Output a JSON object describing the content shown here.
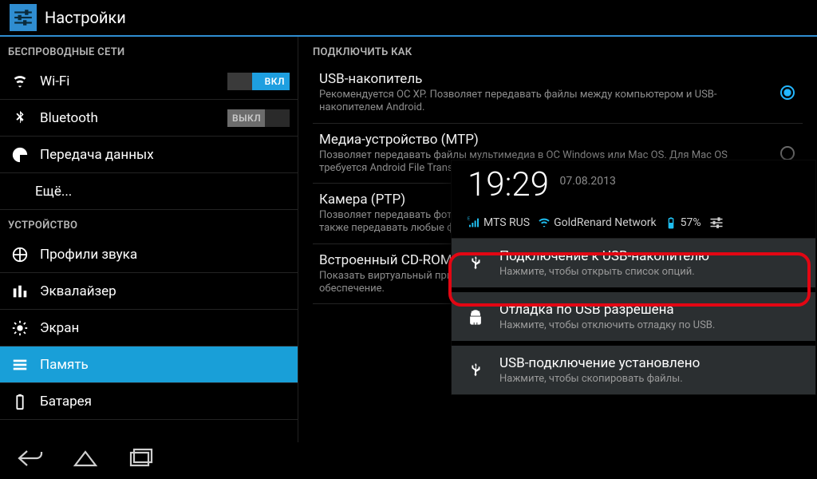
{
  "titlebar": {
    "title": "Настройки"
  },
  "sidebar": {
    "section_wireless": "БЕСПРОВОДНЫЕ СЕТИ",
    "section_device": "УСТРОЙСТВО",
    "wifi": {
      "label": "Wi-Fi",
      "toggle": "ВКЛ"
    },
    "bluetooth": {
      "label": "Bluetooth",
      "toggle": "ВЫКЛ"
    },
    "data": {
      "label": "Передача данных"
    },
    "more": {
      "label": "Ещё..."
    },
    "sound": {
      "label": "Профили звука"
    },
    "eq": {
      "label": "Эквалайзер"
    },
    "display": {
      "label": "Экран"
    },
    "storage": {
      "label": "Память"
    },
    "battery": {
      "label": "Батарея"
    }
  },
  "content": {
    "header": "ПОДКЛЮЧИТЬ КАК",
    "options": {
      "usb_mass": {
        "title": "USB-накопитель",
        "sub": "Рекомендуется ОС XP. Позволяет передавать файлы между компьютером и USB-накопителем Android.",
        "selected": true
      },
      "mtp": {
        "title": "Медиа-устройство (MTP)",
        "sub": "Позволяет передавать файлы мультимедиа в ОС Windows или Mac OS. Для Mac OS требуется Android File Transfer."
      },
      "ptp": {
        "title": "Камера (PTP)",
        "sub": "Позволяет передавать фотографии с помощью программного обеспечения камеры, а также передавать любые файлы на компьютеры, которые не поддерживают MTP"
      },
      "cdrom": {
        "title": "Встроенный CD-ROM",
        "sub": "Показать виртуальный привод CD-ROM, содержащий полезное программное обеспечение."
      }
    }
  },
  "shade": {
    "time": "19:29",
    "date": "07.08.2013",
    "carrier": "MTS RUS",
    "wifi_name": "GoldRenard Network",
    "battery": "57%",
    "notifications": {
      "usb_storage": {
        "title": "Подключение к USB-накопителю",
        "sub": "Нажмите, чтобы открыть список опций."
      },
      "adb": {
        "title": "Отладка по USB разрешена",
        "sub": "Нажмите, чтобы отключить отладку по USB."
      },
      "usb_connected": {
        "title": "USB-подключение установлено",
        "sub": "Нажмите, чтобы скопировать файлы."
      }
    }
  }
}
